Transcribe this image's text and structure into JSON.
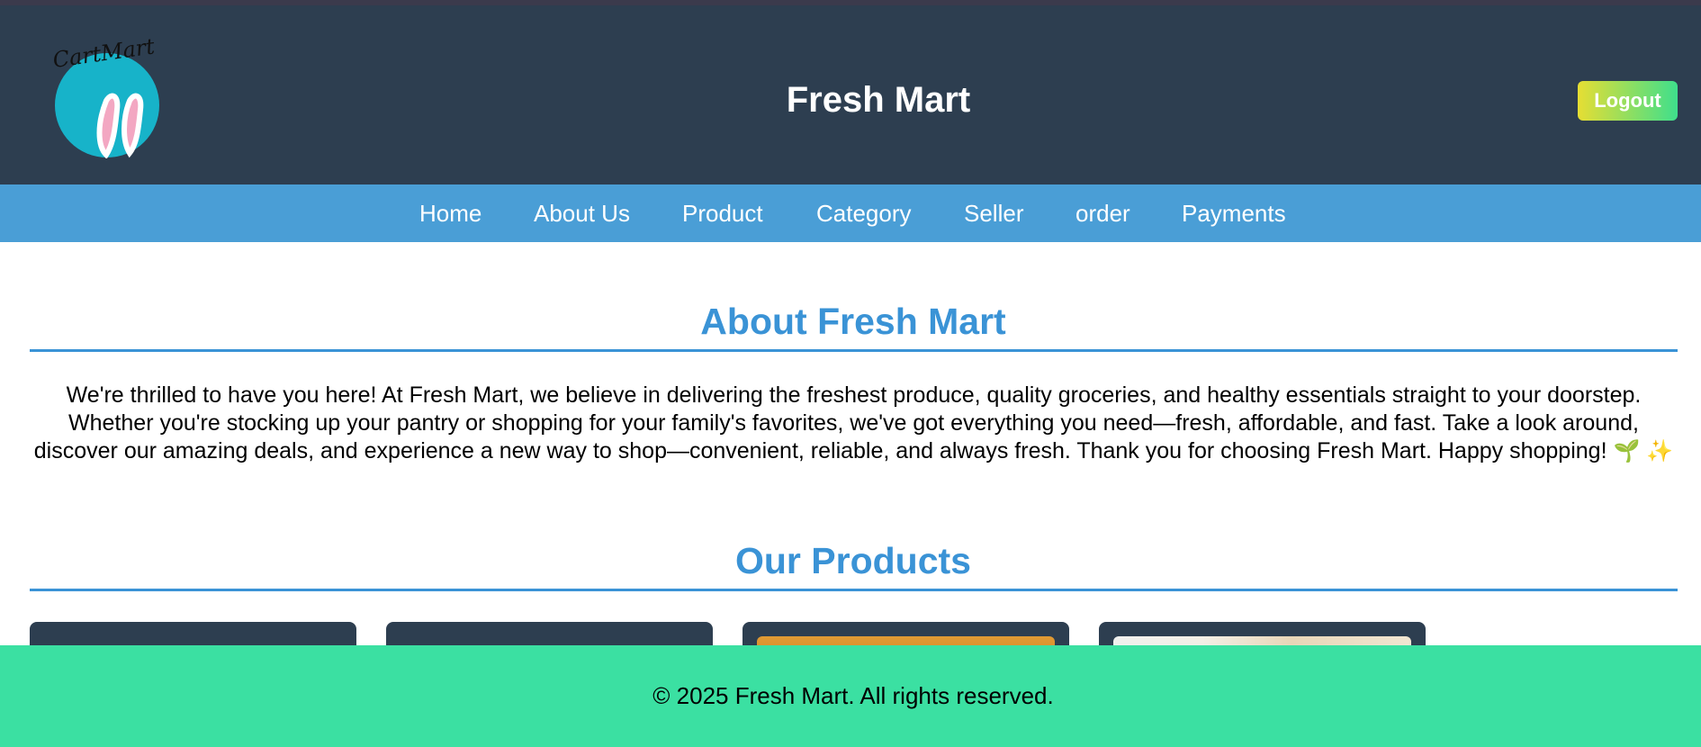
{
  "header": {
    "logo_text": "CartMart",
    "title": "Fresh Mart",
    "logout_label": "Logout"
  },
  "nav": {
    "items": [
      {
        "label": "Home"
      },
      {
        "label": "About Us"
      },
      {
        "label": "Product"
      },
      {
        "label": "Category"
      },
      {
        "label": "Seller"
      },
      {
        "label": "order"
      },
      {
        "label": "Payments"
      }
    ]
  },
  "about": {
    "title": "About Fresh Mart",
    "text": "We're thrilled to have you here! At Fresh Mart, we believe in delivering the freshest produce, quality groceries, and healthy essentials straight to your doorstep. Whether you're stocking up your pantry or shopping for your family's favorites, we've got everything you need—fresh, affordable, and fast. Take a look around, discover our amazing deals, and experience a new way to shop—convenient, reliable, and always fresh. Thank you for choosing Fresh Mart. Happy shopping!",
    "emoji_1": "🌱",
    "emoji_2": "✨"
  },
  "products": {
    "title": "Our Products",
    "cards": [
      {
        "image": "none"
      },
      {
        "image": "none"
      },
      {
        "image": "bread-image"
      },
      {
        "image": "gift-basket-image"
      }
    ]
  },
  "footer": {
    "text": "© 2025 Fresh Mart. All rights reserved."
  },
  "colors": {
    "header_bg": "#2d3e50",
    "nav_bg": "#4a9ed6",
    "accent": "#3a93d6",
    "footer_bg": "#3be0a2"
  }
}
